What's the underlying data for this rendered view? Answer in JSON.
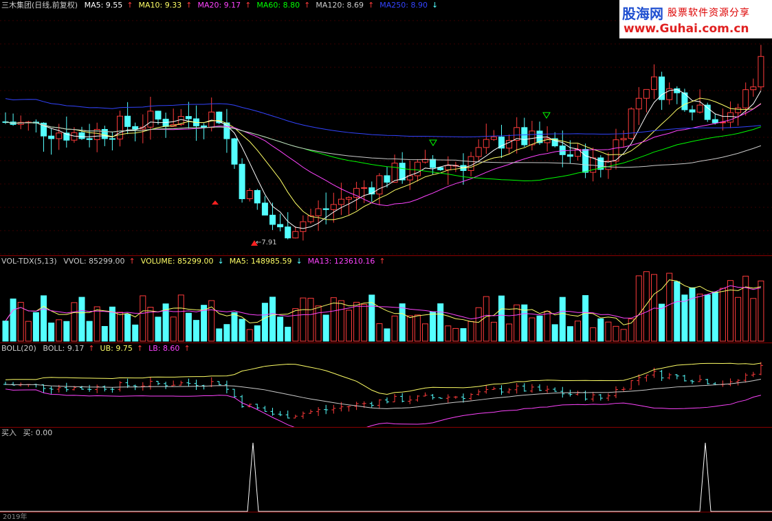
{
  "main": {
    "title": "三木集团(日线,前复权)",
    "ma": [
      {
        "label": "MA5: 9.55",
        "color": "#ffffff",
        "arrow": "↑"
      },
      {
        "label": "MA10: 9.33",
        "color": "#ffff66",
        "arrow": "↑"
      },
      {
        "label": "MA20: 9.17",
        "color": "#ff44ff",
        "arrow": "↑"
      },
      {
        "label": "MA60: 8.80",
        "color": "#00ff00",
        "arrow": "↑"
      },
      {
        "label": "MA120: 8.69",
        "color": "#cccccc",
        "arrow": "↑"
      },
      {
        "label": "MA250: 8.90",
        "color": "#3344ff",
        "arrow": "↓"
      }
    ],
    "low_marker": "7.91"
  },
  "volume": {
    "title": "VOL-TDX(5,13)",
    "items": [
      {
        "label": "VVOL: 85299.00",
        "color": "#cccccc",
        "arrow": "↑"
      },
      {
        "label": "VOLUME: 85299.00",
        "color": "#ffff66",
        "arrow": "↓"
      },
      {
        "label": "MA5: 148985.59",
        "color": "#ffff66",
        "arrow": "↓"
      },
      {
        "label": "MA13: 123610.16",
        "color": "#ff44ff",
        "arrow": "↑"
      }
    ]
  },
  "boll": {
    "title": "BOLL(20)",
    "items": [
      {
        "label": "BOLL: 9.17",
        "color": "#cccccc",
        "arrow": "↑"
      },
      {
        "label": "UB: 9.75",
        "color": "#ffff66",
        "arrow": "↑"
      },
      {
        "label": "LB: 8.60",
        "color": "#ff44ff",
        "arrow": "↑"
      }
    ]
  },
  "signal": {
    "title": "买入",
    "value": "买: 0.00"
  },
  "logo": {
    "name": "股海网",
    "slogan": "股票软件资源分享",
    "url": "www.Guhai.com.cn"
  },
  "axis": {
    "year_label": "2019年"
  },
  "colors": {
    "up": "#ff3b3b",
    "down": "#54ffff",
    "bg": "#000000",
    "divider": "#8b0000"
  }
}
